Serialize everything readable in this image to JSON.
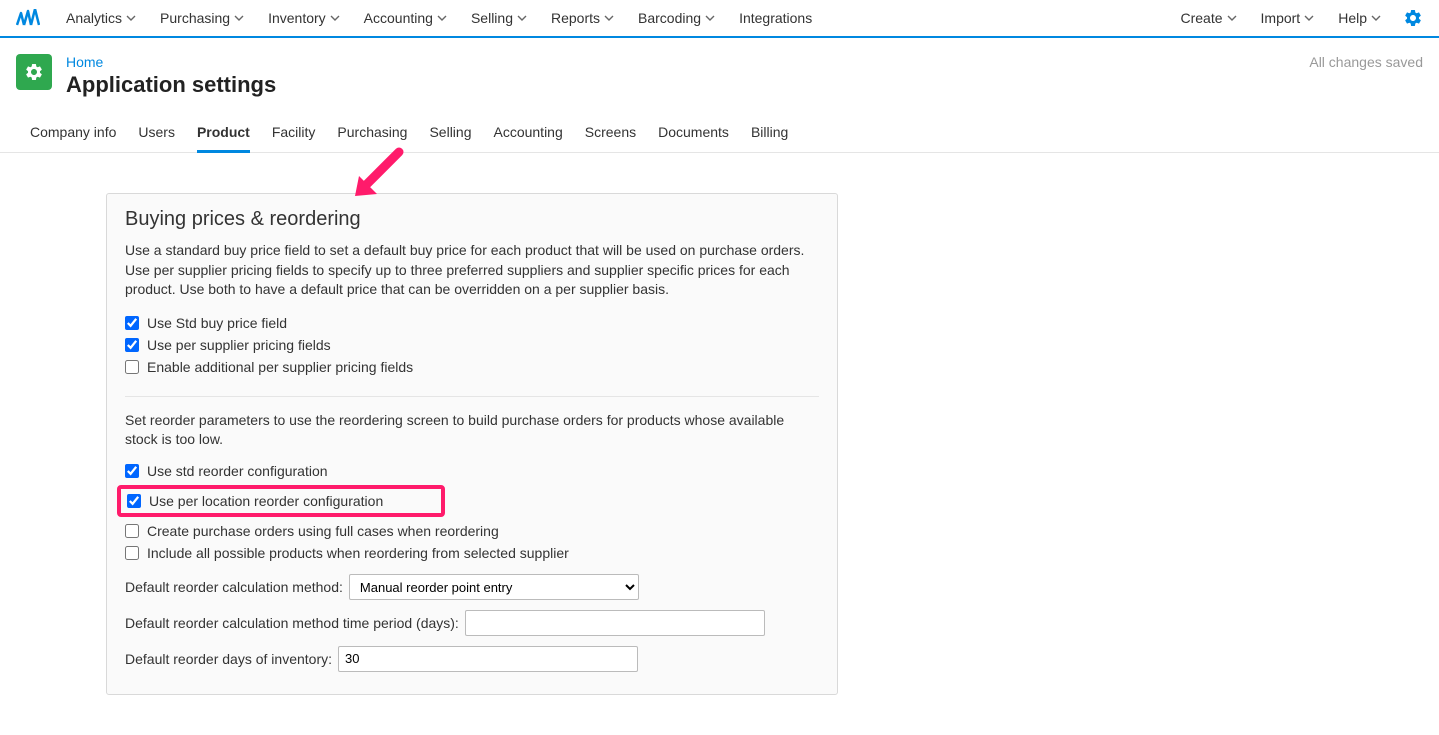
{
  "topnav": {
    "left": [
      "Analytics",
      "Purchasing",
      "Inventory",
      "Accounting",
      "Selling",
      "Reports",
      "Barcoding",
      "Integrations"
    ],
    "left_has_chevron": [
      true,
      true,
      true,
      true,
      true,
      true,
      true,
      false
    ],
    "right": [
      "Create",
      "Import",
      "Help"
    ]
  },
  "header": {
    "breadcrumb": "Home",
    "title": "Application settings",
    "save_status": "All changes saved"
  },
  "tabs": [
    "Company info",
    "Users",
    "Product",
    "Facility",
    "Purchasing",
    "Selling",
    "Accounting",
    "Screens",
    "Documents",
    "Billing"
  ],
  "active_tab": "Product",
  "panel": {
    "title": "Buying prices & reordering",
    "desc1": "Use a standard buy price field to set a default buy price for each product that will be used on purchase orders. Use per supplier pricing fields to specify up to three preferred suppliers and supplier specific prices for each product. Use both to have a default price that can be overridden on a per supplier basis.",
    "checks1": [
      {
        "label": "Use Std buy price field",
        "checked": true
      },
      {
        "label": "Use per supplier pricing fields",
        "checked": true
      },
      {
        "label": "Enable additional per supplier pricing fields",
        "checked": false
      }
    ],
    "desc2": "Set reorder parameters to use the reordering screen to build purchase orders for products whose available stock is too low.",
    "checks2": [
      {
        "label": "Use std reorder configuration",
        "checked": true
      },
      {
        "label": "Use per location reorder configuration",
        "checked": true,
        "highlight": true
      },
      {
        "label": "Create purchase orders using full cases when reordering",
        "checked": false
      },
      {
        "label": "Include all possible products when reordering from selected supplier",
        "checked": false
      }
    ],
    "field1_label": "Default reorder calculation method:",
    "field1_value": "Manual reorder point entry",
    "field2_label": "Default reorder calculation method time period (days):",
    "field2_value": "",
    "field3_label": "Default reorder days of inventory:",
    "field3_value": "30"
  }
}
